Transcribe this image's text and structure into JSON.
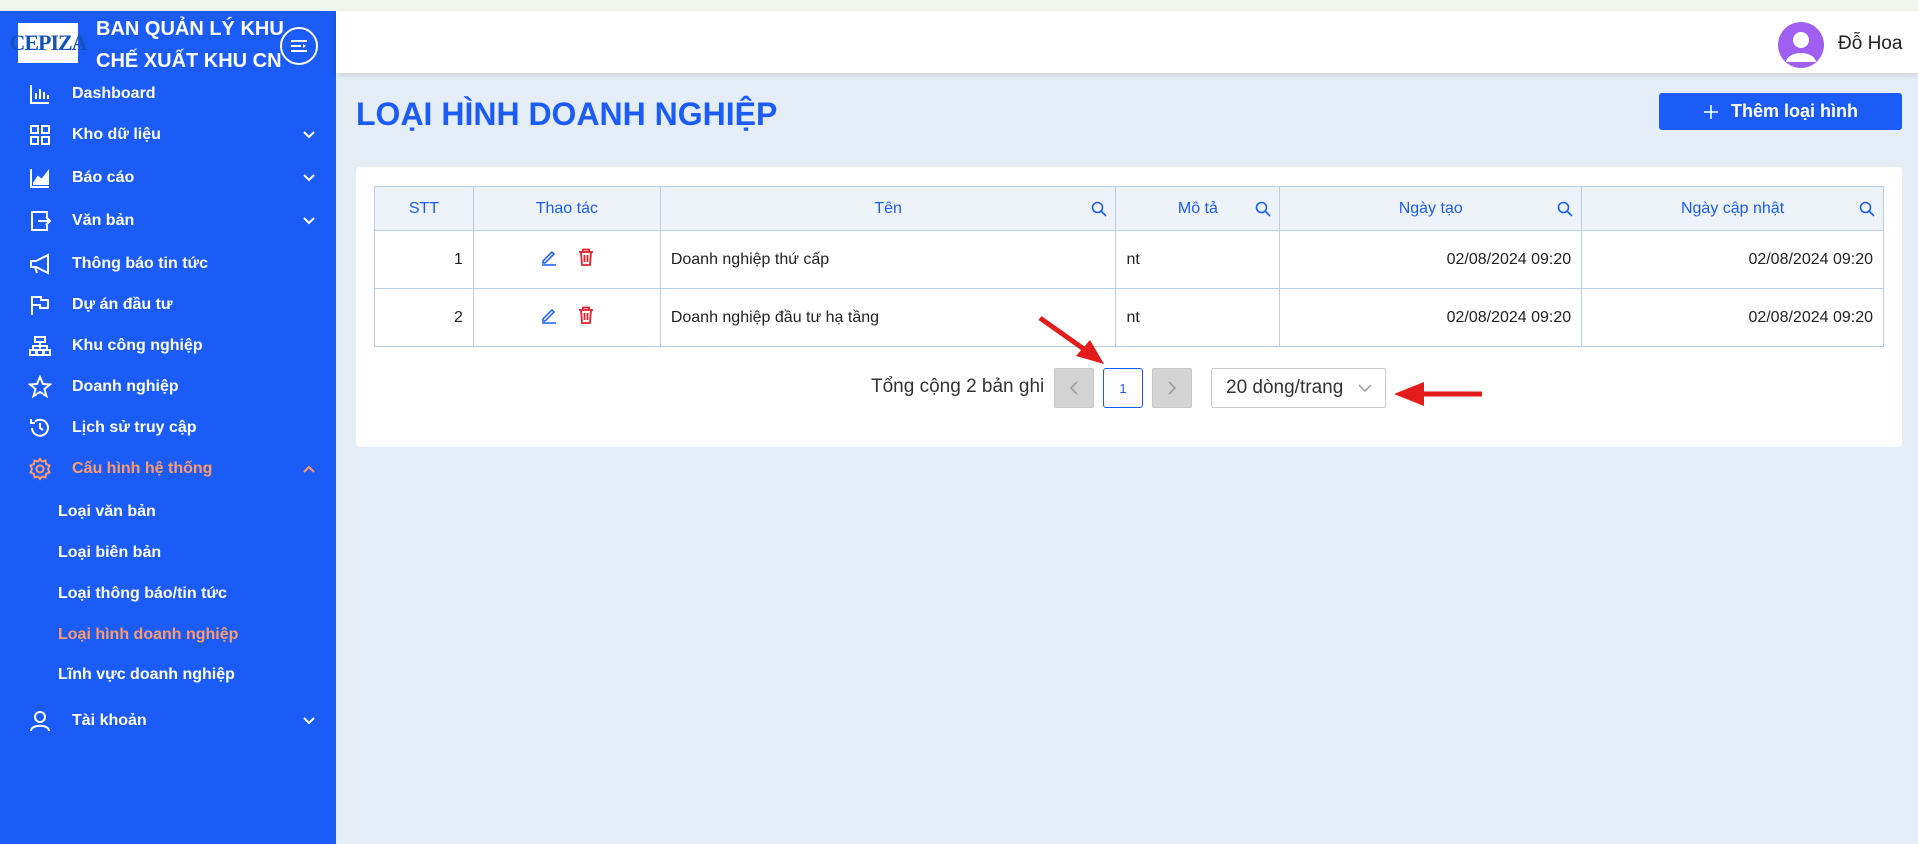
{
  "brand": {
    "logo_text": "CEPIZA",
    "title": "BAN QUẢN LÝ KHU CHẾ XUẤT KHU CN"
  },
  "sidebar": {
    "items": [
      {
        "label": "Dashboard",
        "icon": "bar-chart-icon",
        "has_children": false
      },
      {
        "label": "Kho dữ liệu",
        "icon": "grid-icon",
        "has_children": true
      },
      {
        "label": "Báo cáo",
        "icon": "area-chart-icon",
        "has_children": true
      },
      {
        "label": "Văn bản",
        "icon": "export-icon",
        "has_children": true
      },
      {
        "label": "Thông báo tin tức",
        "icon": "megaphone-icon",
        "has_children": false
      },
      {
        "label": "Dự án đầu tư",
        "icon": "flag-icon",
        "has_children": false
      },
      {
        "label": "Khu công nghiệp",
        "icon": "cluster-icon",
        "has_children": false
      },
      {
        "label": "Doanh nghiệp",
        "icon": "star-icon",
        "has_children": false
      },
      {
        "label": "Lịch sử truy cập",
        "icon": "history-icon",
        "has_children": false
      },
      {
        "label": "Cấu hình hệ thống",
        "icon": "gear-icon",
        "has_children": true,
        "expanded": true
      },
      {
        "label": "Tài khoản",
        "icon": "user-icon",
        "has_children": true
      }
    ],
    "subitems": [
      {
        "label": "Loại văn bản"
      },
      {
        "label": "Loại biên bản"
      },
      {
        "label": "Loại thông báo/tin tức"
      },
      {
        "label": "Loại hình doanh nghiệp",
        "active": true
      },
      {
        "label": "Lĩnh vực doanh nghiệp"
      }
    ],
    "active_color": "#ff9a6b",
    "bg_color": "#1a5cf5"
  },
  "header": {
    "username": "Đỗ Hoa"
  },
  "main": {
    "title": "LOẠI HÌNH DOANH NGHIỆP",
    "add_button": "Thêm loại hình",
    "table": {
      "columns": [
        "STT",
        "Thao tác",
        "Tên",
        "Mô tả",
        "Ngày tạo",
        "Ngày cập nhật"
      ],
      "rows": [
        {
          "stt": "1",
          "name": "Doanh nghiệp thứ cấp",
          "desc": "nt",
          "created": "02/08/2024 09:20",
          "updated": "02/08/2024 09:20"
        },
        {
          "stt": "2",
          "name": "Doanh nghiệp đầu tư hạ tầng",
          "desc": "nt",
          "created": "02/08/2024 09:20",
          "updated": "02/08/2024 09:20"
        }
      ]
    },
    "pagination": {
      "total_text": "Tổng cộng 2 bản ghi",
      "current_page": "1",
      "page_size": "20 dòng/trang"
    }
  }
}
